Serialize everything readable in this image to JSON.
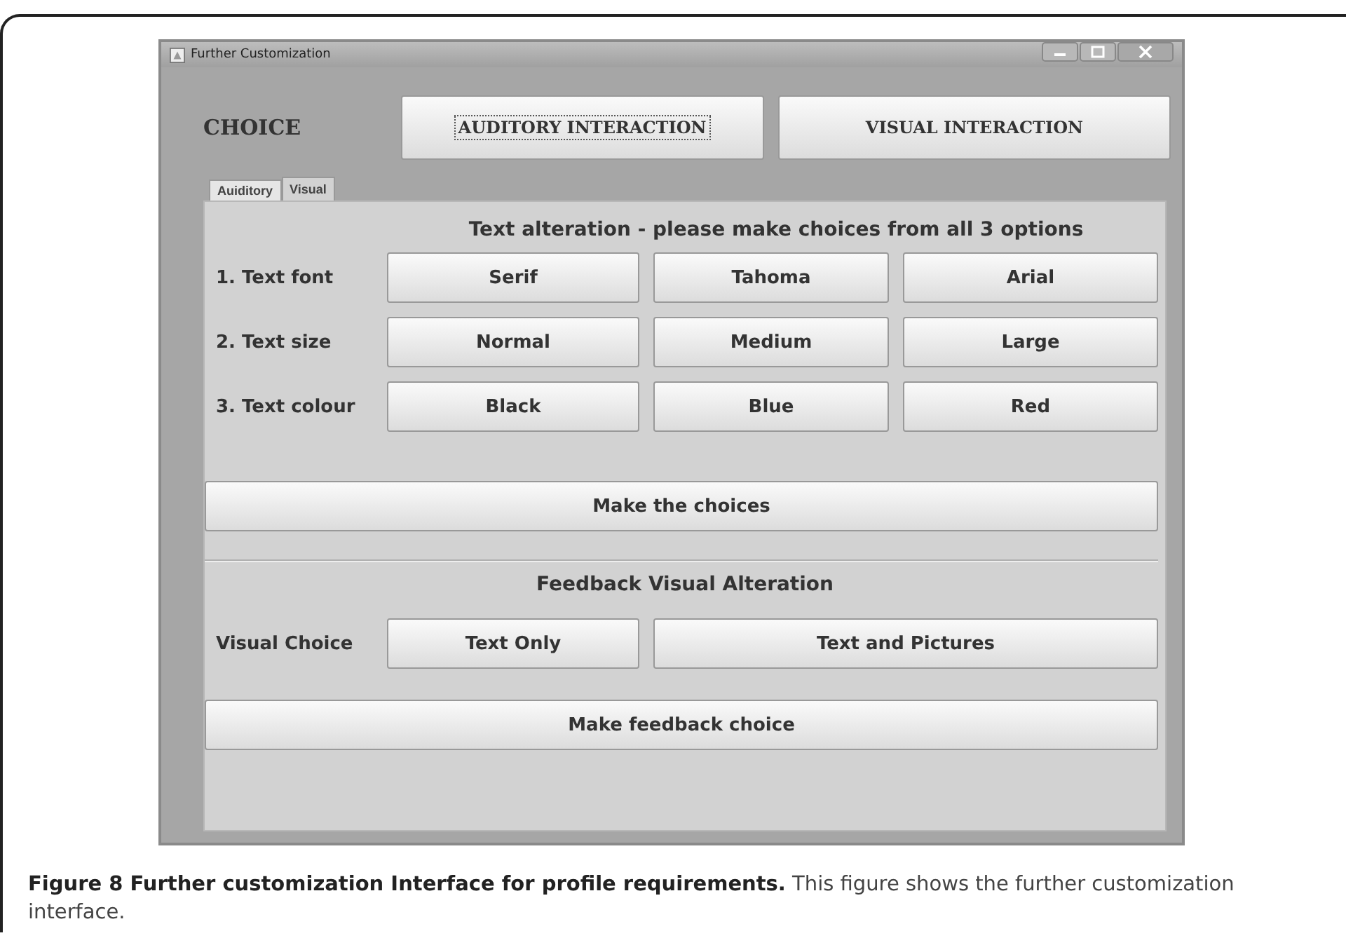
{
  "window": {
    "title": "Further Customization"
  },
  "choice": {
    "label": "CHOICE",
    "buttons": [
      {
        "label": "AUDITORY INTERACTION",
        "focused": true
      },
      {
        "label": "VISUAL INTERACTION",
        "focused": false
      }
    ]
  },
  "tabs": [
    {
      "label": "Auiditory",
      "selected": false
    },
    {
      "label": "Visual",
      "selected": true
    }
  ],
  "text_alteration": {
    "heading": "Text alteration - please make choices from all 3 options",
    "rows": [
      {
        "label": "1. Text font",
        "options": [
          "Serif",
          "Tahoma",
          "Arial"
        ]
      },
      {
        "label": "2. Text size",
        "options": [
          "Normal",
          "Medium",
          "Large"
        ]
      },
      {
        "label": "3. Text colour",
        "options": [
          "Black",
          "Blue",
          "Red"
        ]
      }
    ],
    "submit": "Make the choices"
  },
  "feedback": {
    "heading": "Feedback Visual Alteration",
    "label": "Visual Choice",
    "options": [
      "Text Only",
      "Text and Pictures"
    ],
    "submit": "Make feedback choice"
  },
  "caption": "**Figure 8 Further customization Interface for profile requirements.** This figure shows the further customization interface."
}
